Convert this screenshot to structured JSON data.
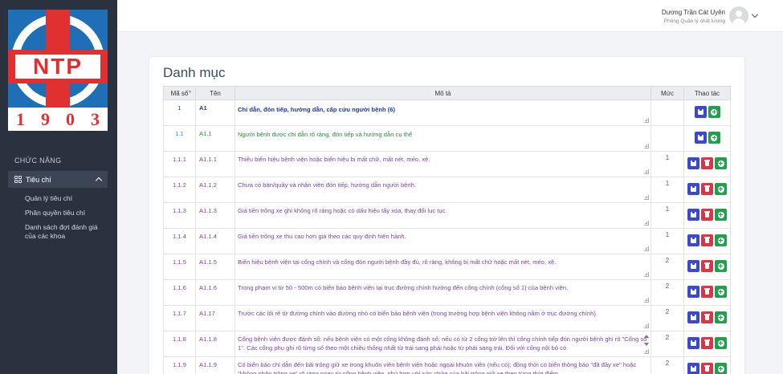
{
  "logo": {
    "letters": "NTP",
    "year_digits": [
      "1",
      "9",
      "0",
      "3"
    ]
  },
  "sidebar": {
    "heading": "CHỨC NĂNG",
    "group_label": "Tiêu chí",
    "items": [
      {
        "label": "Quản lý tiêu chí"
      },
      {
        "label": "Phân quyền tiêu chí"
      },
      {
        "label": "Danh sách đợt đánh giá của các khoa"
      }
    ]
  },
  "user": {
    "name": "Dương Trần Cát Uyên",
    "role": "Phòng Quản lý chất lượng"
  },
  "page": {
    "title": "Danh mục"
  },
  "table": {
    "headers": {
      "ma_so": "Mã số",
      "ten": "Tên",
      "mo_ta": "Mô tả",
      "muc": "Mức",
      "thao_tac": "Thao tác"
    },
    "sort_icon": "▲▼",
    "rows": [
      {
        "code": "1",
        "name": "A1",
        "desc": "Chỉ dẫn, đón tiếp, hướng dẫn, cấp cứu người bệnh (6)",
        "level": "",
        "level_type": 1,
        "actions": [
          "save",
          "add"
        ]
      },
      {
        "code": "1.1",
        "name": "A1.1",
        "desc": "Người bệnh được chỉ dẫn rõ ràng, đón tiếp và hướng dẫn cụ thể",
        "level": "",
        "level_type": 2,
        "actions": [
          "save",
          "add"
        ]
      },
      {
        "code": "1.1.1",
        "name": "A1.1.1",
        "desc": "Thiếu biển hiệu bệnh viện hoặc biển hiệu bị mất chữ, mất nét, méo, xệ.",
        "level": "1",
        "level_type": 3,
        "actions": [
          "save",
          "del",
          "add"
        ]
      },
      {
        "code": "1.1.2",
        "name": "A1.1.2",
        "desc": "Chưa có bàn/quầy và nhân viên đón tiếp, hướng dẫn người bệnh.",
        "level": "1",
        "level_type": 3,
        "actions": [
          "save",
          "del",
          "add"
        ]
      },
      {
        "code": "1.1.3",
        "name": "A1.1.3",
        "desc": "Giá tiền trông xe ghi không rõ ràng hoặc có dấu hiệu tẩy xóa, thay đổi lục tục.",
        "level": "1",
        "level_type": 3,
        "actions": [
          "save",
          "del",
          "add"
        ]
      },
      {
        "code": "1.1.4",
        "name": "A1.1.4",
        "desc": "Giá tiền trông xe thu cao hơn giá theo các quy định hiện hành.",
        "level": "1",
        "level_type": 3,
        "actions": [
          "save",
          "del",
          "add"
        ]
      },
      {
        "code": "1.1.5",
        "name": "A1.1.5",
        "desc": "Biển hiệu bệnh viện tại cổng chính và cổng đón người bệnh đầy đủ, rõ ràng, không bị mất chữ hoặc mất nét, méo, xệ.",
        "level": "2",
        "level_type": 3,
        "actions": [
          "save",
          "del",
          "add"
        ]
      },
      {
        "code": "1.1.6",
        "name": "A1.1.6",
        "desc": "Trong phạm vi từ 50 - 500m có biển báo bệnh viện tại trục đường chính hướng đến cổng chính (cổng số 1) của bệnh viện.",
        "level": "2",
        "level_type": 3,
        "actions": [
          "save",
          "del",
          "add"
        ]
      },
      {
        "code": "1.1.7",
        "name": "A1.17",
        "desc": "Trước các lối rẽ từ đường chính vào đường nhỏ có biển báo bệnh viện (trong trường hợp bệnh viện không nằm ở trục đường chính).",
        "level": "2",
        "level_type": 3,
        "actions": [
          "save",
          "del",
          "add"
        ]
      },
      {
        "code": "1.1.8",
        "name": "A1.1.8",
        "desc": "Cổng bệnh viện được đánh số: nếu bệnh viện có một cổng không đánh số; nếu có từ 2 cổng trở lên thì cổng chính tiếp đón người bệnh ghi rõ \"Cổng số 1\". Các cổng phụ ghi rõ từng số theo một chiều thống nhất từ trái sang phải hoặc từ phải sang trái. Đối với cổng nội bộ có",
        "level": "2",
        "level_type": 3,
        "actions": [
          "save",
          "del",
          "add"
        ],
        "scroll": true
      },
      {
        "code": "1.1.9",
        "name": "A1.1.9",
        "desc": "Có biển báo chỉ dẫn đến bãi trông giữ xe trong khuôn viên bệnh viện hoặc ngoài khuôn viên (nếu có); đồng thời có biển thông báo \"đã đầy xe\" hoặc \"không nhận trông xe\" rõ ràng ngay từ cổng bệnh viện, phù hợp với sức chứa của bãi trông giữ xe theo từng thời điểm.",
        "level": "2",
        "level_type": 3,
        "actions": [
          "save",
          "del",
          "add"
        ]
      }
    ]
  }
}
